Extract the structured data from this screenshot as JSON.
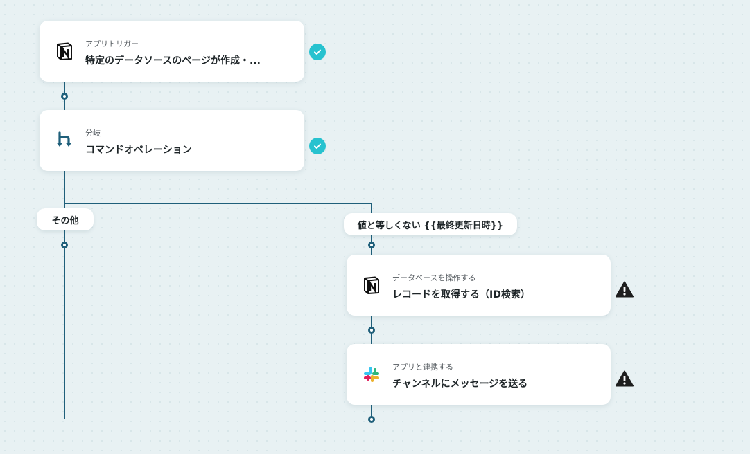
{
  "flow": {
    "trigger": {
      "category": "アプリトリガー",
      "title": "特定のデータソースのページが作成・...",
      "icon": "notion-icon",
      "status": "complete"
    },
    "branch": {
      "category": "分岐",
      "title": "コマンドオペレーション",
      "icon": "branch-icon",
      "status": "complete"
    },
    "branches": {
      "other_label": "その他",
      "condition_label": "値と等しくない {{最終更新日時}}"
    },
    "step_notion": {
      "category": "データベースを操作する",
      "title": "レコードを取得する（ID検索）",
      "icon": "notion-icon",
      "status": "warning"
    },
    "step_slack": {
      "category": "アプリと連携する",
      "title": "チャンネルにメッセージを送る",
      "icon": "slack-icon",
      "status": "warning"
    }
  },
  "colors": {
    "line": "#1f5f7a",
    "check": "#27c2cf",
    "warning": "#1e1e1e",
    "background": "#e8f1f3"
  }
}
